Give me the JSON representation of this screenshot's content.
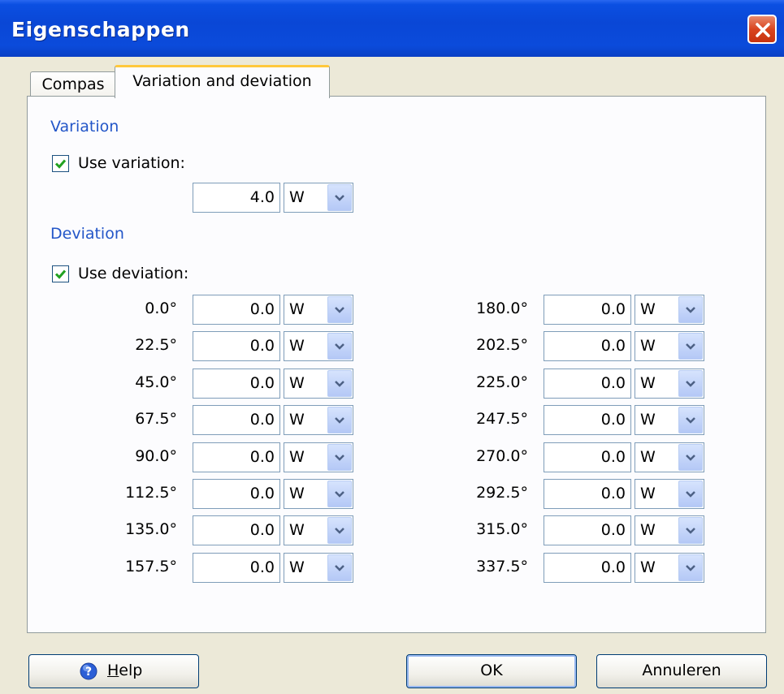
{
  "window": {
    "title": "Eigenschappen",
    "colors": {
      "titlebar": "#0a47d6",
      "section_label": "#2356c8",
      "close_button": "#d9451f"
    }
  },
  "tabs": [
    {
      "label": "Compas",
      "active": false
    },
    {
      "label": "Variation and deviation",
      "active": true
    }
  ],
  "variation": {
    "section_label": "Variation",
    "checkbox_label": "Use variation:",
    "checked": true,
    "value": "4.0",
    "direction": "W"
  },
  "deviation": {
    "section_label": "Deviation",
    "checkbox_label": "Use deviation:",
    "checked": true,
    "rows": [
      {
        "heading": "0.0°",
        "value": "0.0",
        "direction": "W"
      },
      {
        "heading": "22.5°",
        "value": "0.0",
        "direction": "W"
      },
      {
        "heading": "45.0°",
        "value": "0.0",
        "direction": "W"
      },
      {
        "heading": "67.5°",
        "value": "0.0",
        "direction": "W"
      },
      {
        "heading": "90.0°",
        "value": "0.0",
        "direction": "W"
      },
      {
        "heading": "112.5°",
        "value": "0.0",
        "direction": "W"
      },
      {
        "heading": "135.0°",
        "value": "0.0",
        "direction": "W"
      },
      {
        "heading": "157.5°",
        "value": "0.0",
        "direction": "W"
      },
      {
        "heading": "180.0°",
        "value": "0.0",
        "direction": "W"
      },
      {
        "heading": "202.5°",
        "value": "0.0",
        "direction": "W"
      },
      {
        "heading": "225.0°",
        "value": "0.0",
        "direction": "W"
      },
      {
        "heading": "247.5°",
        "value": "0.0",
        "direction": "W"
      },
      {
        "heading": "270.0°",
        "value": "0.0",
        "direction": "W"
      },
      {
        "heading": "292.5°",
        "value": "0.0",
        "direction": "W"
      },
      {
        "heading": "315.0°",
        "value": "0.0",
        "direction": "W"
      },
      {
        "heading": "337.5°",
        "value": "0.0",
        "direction": "W"
      }
    ]
  },
  "buttons": {
    "help": {
      "label_underlined": "H",
      "label_rest": "elp",
      "icon": "help-icon"
    },
    "ok": "OK",
    "cancel": "Annuleren"
  }
}
